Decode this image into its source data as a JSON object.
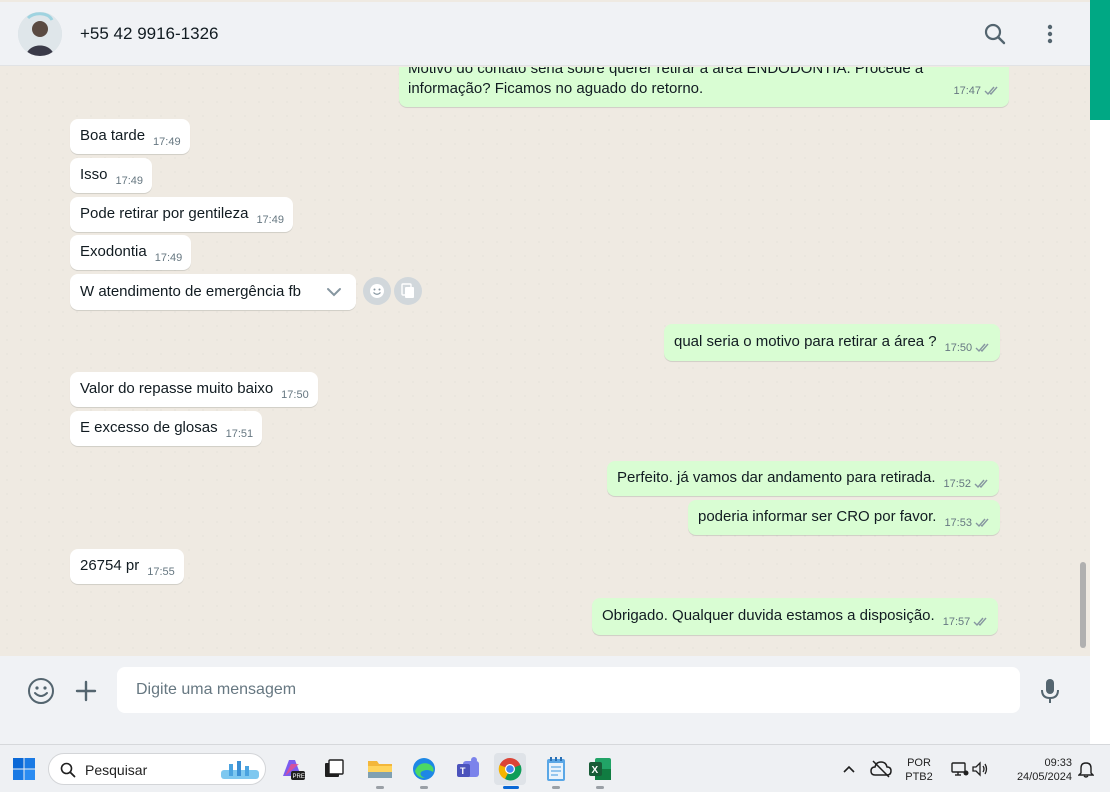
{
  "header": {
    "contact_name": "+55 42 9916-1326",
    "icons": [
      "search-icon",
      "menu-dots-icon"
    ]
  },
  "messages": [
    {
      "dir": "out",
      "text_top": "Motivo do contato seria sobre querer retirar a área ENDODONTIA. Procede a",
      "text": "informação? Ficamos no aguado do retorno.",
      "time": "17:47"
    },
    {
      "dir": "in",
      "text": "Boa tarde",
      "time": "17:49"
    },
    {
      "dir": "in",
      "text": "Isso",
      "time": "17:49"
    },
    {
      "dir": "in",
      "text": "Pode retirar por gentileza",
      "time": "17:49"
    },
    {
      "dir": "in",
      "text": "Exodontia",
      "time": "17:49"
    },
    {
      "dir": "in",
      "text": "W atendimento de emergência fb",
      "time": ""
    },
    {
      "dir": "out",
      "text": "qual seria o motivo para retirar a área ?",
      "time": "17:50"
    },
    {
      "dir": "in",
      "text": "Valor do repasse muito baixo",
      "time": "17:50"
    },
    {
      "dir": "in",
      "text": "E excesso de glosas",
      "time": "17:51"
    },
    {
      "dir": "out",
      "text": "Perfeito. já vamos dar andamento para retirada.",
      "time": "17:52"
    },
    {
      "dir": "out",
      "text": "poderia informar ser CRO por favor.",
      "time": "17:53"
    },
    {
      "dir": "in",
      "text": "26754 pr",
      "time": "17:55"
    },
    {
      "dir": "out",
      "text": "Obrigado. Qualquer duvida estamos a disposição.",
      "time": "17:57"
    }
  ],
  "composer": {
    "placeholder": "Digite uma mensagem"
  },
  "taskbar": {
    "search_label": "Pesquisar",
    "lang_top": "POR",
    "lang_bottom": "PTB2",
    "time": "09:33",
    "date": "24/05/2024"
  },
  "colors": {
    "outgoing_bubble": "#d9fdd3",
    "incoming_bubble": "#ffffff",
    "accent": "#00a884",
    "read_ticks": "#8696a0"
  }
}
